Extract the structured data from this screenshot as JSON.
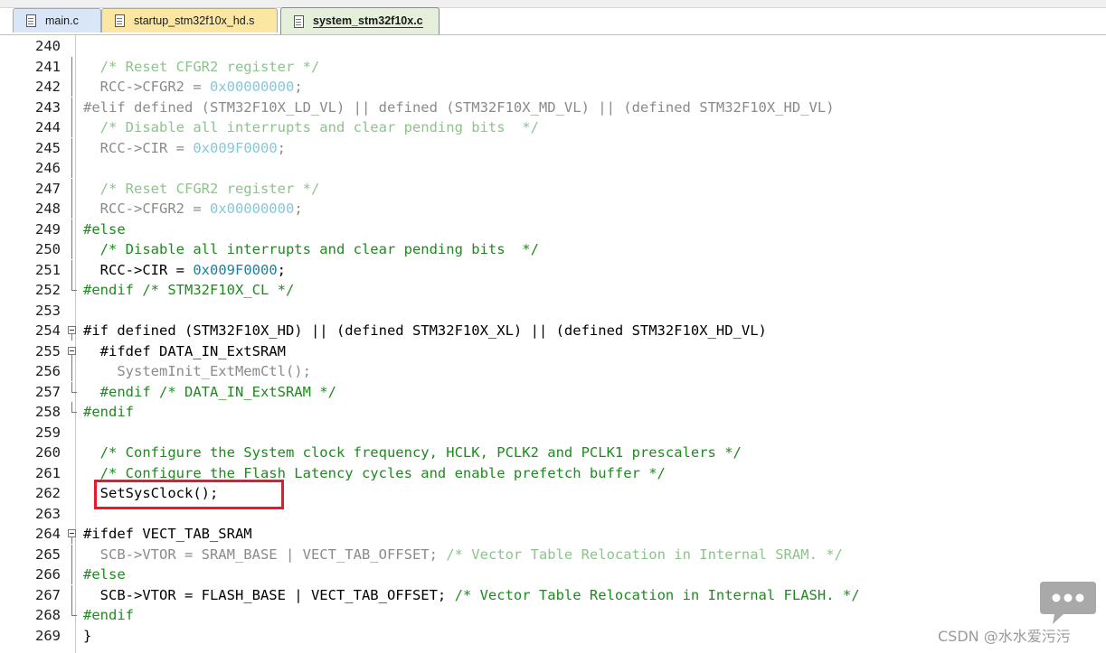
{
  "tabs": [
    {
      "label": "main.c",
      "active": false
    },
    {
      "label": "startup_stm32f10x_hd.s",
      "active": false
    },
    {
      "label": "system_stm32f10x.c",
      "active": true
    }
  ],
  "colors": {
    "highlight_box": "#e8192c",
    "comment": "#1e8a1e",
    "number": "#1f7f9f",
    "inactive_code": "#8a8a8a"
  },
  "fold_icon": "fold-minus-icon",
  "watermark": {
    "icon": "chat-bubble-icon",
    "text": "CSDN @水水爱污污"
  },
  "lines": [
    {
      "num": "240",
      "fold": "",
      "tokens": []
    },
    {
      "num": "241",
      "fold": "line",
      "tokens": [
        {
          "t": "  /* Reset CFGR2 register */",
          "c": "fade-comment"
        }
      ]
    },
    {
      "num": "242",
      "fold": "line",
      "tokens": [
        {
          "t": "  RCC->CFGR2 = ",
          "c": "fade-text"
        },
        {
          "t": "0x00000000",
          "c": "fade-num"
        },
        {
          "t": ";",
          "c": "fade-text"
        }
      ]
    },
    {
      "num": "243",
      "fold": "line",
      "tokens": [
        {
          "t": "#elif defined (STM32F10X_LD_VL) || defined (STM32F10X_MD_VL) || (defined STM32F10X_HD_VL)",
          "c": "fade-pp"
        }
      ]
    },
    {
      "num": "244",
      "fold": "line",
      "tokens": [
        {
          "t": "  /* Disable all interrupts and clear pending bits  */",
          "c": "fade-comment"
        }
      ]
    },
    {
      "num": "245",
      "fold": "line",
      "tokens": [
        {
          "t": "  RCC->CIR = ",
          "c": "fade-text"
        },
        {
          "t": "0x009F0000",
          "c": "fade-num"
        },
        {
          "t": ";",
          "c": "fade-text"
        }
      ]
    },
    {
      "num": "246",
      "fold": "line",
      "tokens": []
    },
    {
      "num": "247",
      "fold": "line",
      "tokens": [
        {
          "t": "  /* Reset CFGR2 register */",
          "c": "fade-comment"
        }
      ]
    },
    {
      "num": "248",
      "fold": "line",
      "tokens": [
        {
          "t": "  RCC->CFGR2 = ",
          "c": "fade-text"
        },
        {
          "t": "0x00000000",
          "c": "fade-num"
        },
        {
          "t": ";",
          "c": "fade-text"
        }
      ]
    },
    {
      "num": "249",
      "fold": "line",
      "tokens": [
        {
          "t": "#else",
          "c": "pp"
        }
      ]
    },
    {
      "num": "250",
      "fold": "line",
      "tokens": [
        {
          "t": "  /* Disable all interrupts and clear pending bits  */",
          "c": "comment"
        }
      ]
    },
    {
      "num": "251",
      "fold": "line",
      "tokens": [
        {
          "t": "  RCC->CIR = ",
          "c": "text"
        },
        {
          "t": "0x009F0000",
          "c": "num"
        },
        {
          "t": ";",
          "c": "text"
        }
      ]
    },
    {
      "num": "252",
      "fold": "end",
      "tokens": [
        {
          "t": "#endif /* STM32F10X_CL */",
          "c": "pp"
        }
      ]
    },
    {
      "num": "253",
      "fold": "",
      "tokens": []
    },
    {
      "num": "254",
      "fold": "start",
      "tokens": [
        {
          "t": "#if defined (STM32F10X_HD) || (defined STM32F10X_XL) || (defined STM32F10X_HD_VL)",
          "c": "text"
        }
      ]
    },
    {
      "num": "255",
      "fold": "start",
      "tokens": [
        {
          "t": "  #ifdef DATA_IN_ExtSRAM",
          "c": "text"
        }
      ]
    },
    {
      "num": "256",
      "fold": "line",
      "tokens": [
        {
          "t": "    SystemInit_ExtMemCtl();",
          "c": "fade-text"
        }
      ]
    },
    {
      "num": "257",
      "fold": "end",
      "tokens": [
        {
          "t": "  #endif /* DATA_IN_ExtSRAM */",
          "c": "pp"
        }
      ]
    },
    {
      "num": "258",
      "fold": "end",
      "tokens": [
        {
          "t": "#endif",
          "c": "pp"
        }
      ]
    },
    {
      "num": "259",
      "fold": "",
      "tokens": []
    },
    {
      "num": "260",
      "fold": "",
      "tokens": [
        {
          "t": "  /* Configure the System clock frequency, HCLK, PCLK2 and PCLK1 prescalers */",
          "c": "comment"
        }
      ]
    },
    {
      "num": "261",
      "fold": "",
      "tokens": [
        {
          "t": "  /* Configure the Flash Latency cycles and enable prefetch buffer */",
          "c": "comment"
        }
      ]
    },
    {
      "num": "262",
      "fold": "",
      "tokens": [
        {
          "t": "  SetSysClock();",
          "c": "text"
        }
      ]
    },
    {
      "num": "263",
      "fold": "",
      "tokens": []
    },
    {
      "num": "264",
      "fold": "start",
      "tokens": [
        {
          "t": "#ifdef VECT_TAB_SRAM",
          "c": "text"
        }
      ]
    },
    {
      "num": "265",
      "fold": "line",
      "tokens": [
        {
          "t": "  SCB->VTOR = SRAM_BASE | VECT_TAB_OFFSET; ",
          "c": "fade-text"
        },
        {
          "t": "/* Vector Table Relocation in Internal SRAM. */",
          "c": "fade-comment"
        }
      ]
    },
    {
      "num": "266",
      "fold": "line",
      "tokens": [
        {
          "t": "#else",
          "c": "pp"
        }
      ]
    },
    {
      "num": "267",
      "fold": "line",
      "tokens": [
        {
          "t": "  SCB->VTOR = FLASH_BASE | VECT_TAB_OFFSET; ",
          "c": "text"
        },
        {
          "t": "/* Vector Table Relocation in Internal FLASH. */",
          "c": "comment"
        }
      ]
    },
    {
      "num": "268",
      "fold": "end",
      "tokens": [
        {
          "t": "#endif",
          "c": "pp"
        }
      ]
    },
    {
      "num": "269",
      "fold": "",
      "tokens": [
        {
          "t": "}",
          "c": "text"
        }
      ]
    }
  ]
}
